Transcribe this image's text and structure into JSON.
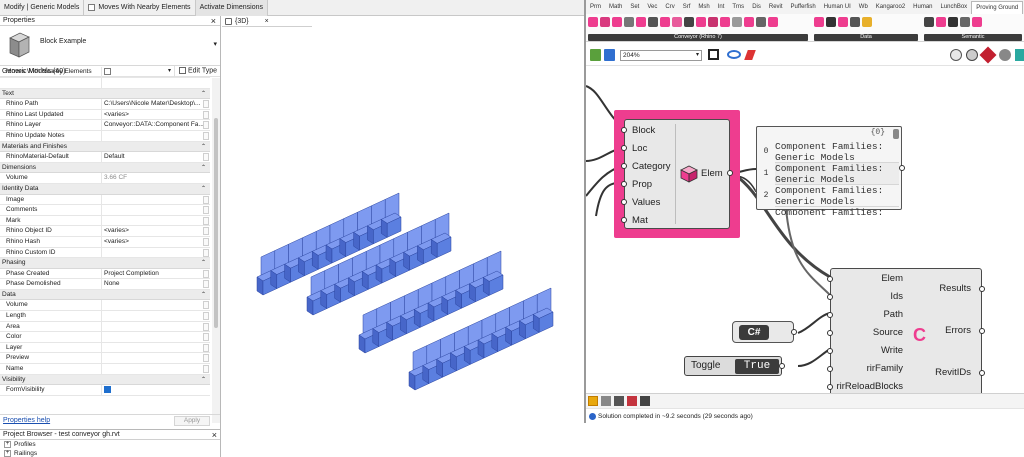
{
  "revit": {
    "topbar": {
      "context": "Modify | Generic Models",
      "moves_with_label": "Moves With Nearby Elements",
      "activate_label": "Activate Dimensions"
    },
    "properties": {
      "title": "Properties",
      "type_name": "Block Example",
      "filter": "Generic Models (40)",
      "edit_type": "Edit Type",
      "moves_row": "Moves With Nearby Elements",
      "rows": [
        {
          "kind": "row",
          "k": "",
          "v": ""
        },
        {
          "kind": "head",
          "k": "Text"
        },
        {
          "kind": "row",
          "k": "Rhino Path",
          "v": "C:\\Users\\Nicole Mater\\Desktop\\..."
        },
        {
          "kind": "row",
          "k": "Rhino Last Updated",
          "v": "<varies>"
        },
        {
          "kind": "row",
          "k": "Rhino Layer",
          "v": "Conveyor::DATA::Component Fa..."
        },
        {
          "kind": "row",
          "k": "Rhino Update Notes",
          "v": ""
        },
        {
          "kind": "head",
          "k": "Materials and Finishes"
        },
        {
          "kind": "row",
          "k": "RhinoMaterial-Default",
          "v": "Default"
        },
        {
          "kind": "head",
          "k": "Dimensions"
        },
        {
          "kind": "row",
          "k": "Volume",
          "v": "3.66 CF",
          "grey": true
        },
        {
          "kind": "head",
          "k": "Identity Data"
        },
        {
          "kind": "row",
          "k": "Image",
          "v": ""
        },
        {
          "kind": "row",
          "k": "Comments",
          "v": ""
        },
        {
          "kind": "row",
          "k": "Mark",
          "v": ""
        },
        {
          "kind": "row",
          "k": "Rhino Object ID",
          "v": "<varies>"
        },
        {
          "kind": "row",
          "k": "Rhino Hash",
          "v": "<varies>"
        },
        {
          "kind": "row",
          "k": "Rhino Custom ID",
          "v": ""
        },
        {
          "kind": "head",
          "k": "Phasing"
        },
        {
          "kind": "row",
          "k": "Phase Created",
          "v": "Project Completion"
        },
        {
          "kind": "row",
          "k": "Phase Demolished",
          "v": "None"
        },
        {
          "kind": "head",
          "k": "Data"
        },
        {
          "kind": "row",
          "k": "Volume",
          "v": ""
        },
        {
          "kind": "row",
          "k": "Length",
          "v": ""
        },
        {
          "kind": "row",
          "k": "Area",
          "v": ""
        },
        {
          "kind": "row",
          "k": "Color",
          "v": ""
        },
        {
          "kind": "row",
          "k": "Layer",
          "v": ""
        },
        {
          "kind": "row",
          "k": "Preview",
          "v": ""
        },
        {
          "kind": "row",
          "k": "Name",
          "v": ""
        },
        {
          "kind": "head",
          "k": "Visibility"
        },
        {
          "kind": "row",
          "k": "FormVisibility",
          "v": "",
          "check": true
        }
      ],
      "help": "Properties help",
      "apply": "Apply"
    },
    "browser": {
      "title": "Project Browser - test conveyor gh.rvt",
      "items": [
        "Profiles",
        "Railings"
      ]
    },
    "view": {
      "tab": "{3D}"
    }
  },
  "gh": {
    "tabs": [
      "Prm",
      "Math",
      "Set",
      "Vec",
      "Crv",
      "Srf",
      "Msh",
      "Int",
      "Trns",
      "Dis",
      "Revit",
      "Pufferfish",
      "Human UI",
      "Wb",
      "Kangaroo2",
      "Human",
      "LunchBox",
      "Proving Ground"
    ],
    "active_tab": "Proving Ground",
    "groups": [
      "Conveyor (Rhino 7)",
      "Data",
      "Semantic"
    ],
    "zoom": "204%",
    "comp1": {
      "inputs": [
        "Block",
        "Loc",
        "Category",
        "Prop",
        "Values",
        "Mat"
      ],
      "output": "Elem"
    },
    "panel": {
      "count": "{0}",
      "items": [
        {
          "i": "0",
          "text": "Component Families:\nGeneric Models"
        },
        {
          "i": "1",
          "text": "Component Families:\nGeneric Models"
        },
        {
          "i": "2",
          "text": "Component Families:\nGeneric Models"
        },
        {
          "i": "",
          "text": "Component Families:"
        }
      ]
    },
    "comp2": {
      "inputs": [
        "Elem",
        "Ids",
        "Path",
        "Source",
        "Write",
        "rirFamily",
        "rirReloadBlocks"
      ],
      "outputs": [
        "Results",
        "Errors",
        "RevitIDs"
      ]
    },
    "toggle": {
      "label": "Toggle",
      "value": "True"
    },
    "status": "Solution completed in ~9.2 seconds (29 seconds ago)",
    "colors": {
      "group_pink": "#ee3d8f",
      "model_blue": "#5b7fe0",
      "accent_blue": "#2b64c8"
    }
  }
}
